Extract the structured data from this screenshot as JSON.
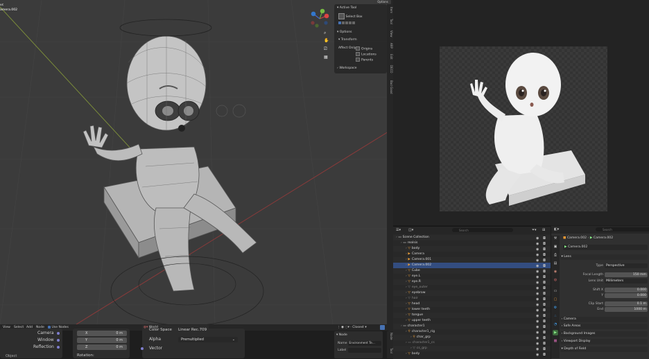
{
  "topbar": {
    "options_label": "Options"
  },
  "viewport": {
    "overlay_title": "vc",
    "overlay_subtitle": "amera.002",
    "n_panel": {
      "active_tool_header": "Active Tool",
      "select_box_label": "Select Box",
      "options_header": "Options",
      "transform_header": "Transform",
      "affect_only_label": "Affect Only",
      "origins_label": "Origins",
      "locations_label": "Locations",
      "parents_label": "Parents",
      "workspace_header": "Workspace"
    },
    "gizmo": {
      "x": "X",
      "y": "Y",
      "z": "Z"
    }
  },
  "side_tabs": [
    "Item",
    "Tool",
    "View",
    "ARP",
    "Edit",
    "DECO",
    "Bad Good"
  ],
  "outliner": {
    "search_placeholder": "Search",
    "rows": [
      {
        "name": "Scene Collection",
        "indent": 0,
        "icon": "collection",
        "color": "#d0d0d0",
        "selected": false
      },
      {
        "name": "realsis",
        "indent": 1,
        "icon": "collection",
        "color": "#d0d0d0",
        "selected": false
      },
      {
        "name": "body",
        "indent": 2,
        "icon": "mesh",
        "color": "#e39a3a",
        "selected": false
      },
      {
        "name": "Camera",
        "indent": 2,
        "icon": "camera",
        "color": "#e39a3a",
        "selected": false
      },
      {
        "name": "Camera.001",
        "indent": 2,
        "icon": "camera",
        "color": "#e39a3a",
        "selected": false
      },
      {
        "name": "Camera.002",
        "indent": 2,
        "icon": "camera",
        "color": "#e39a3a",
        "selected": true
      },
      {
        "name": "Cube",
        "indent": 2,
        "icon": "mesh",
        "color": "#e39a3a",
        "selected": false
      },
      {
        "name": "eye.L",
        "indent": 2,
        "icon": "mesh",
        "color": "#e39a3a",
        "selected": false
      },
      {
        "name": "eye.R",
        "indent": 2,
        "icon": "mesh",
        "color": "#e39a3a",
        "selected": false
      },
      {
        "name": "eye_outer",
        "indent": 2,
        "icon": "mesh",
        "color": "#777777",
        "selected": false
      },
      {
        "name": "eyebrow",
        "indent": 2,
        "icon": "mesh",
        "color": "#e39a3a",
        "selected": false
      },
      {
        "name": "hair",
        "indent": 2,
        "icon": "mesh",
        "color": "#777777",
        "selected": false
      },
      {
        "name": "head",
        "indent": 2,
        "icon": "mesh",
        "color": "#e39a3a",
        "selected": false
      },
      {
        "name": "lower teeth",
        "indent": 2,
        "icon": "mesh",
        "color": "#e39a3a",
        "selected": false
      },
      {
        "name": "tongue",
        "indent": 2,
        "icon": "mesh",
        "color": "#e39a3a",
        "selected": false
      },
      {
        "name": "upper teeth",
        "indent": 2,
        "icon": "mesh",
        "color": "#e39a3a",
        "selected": false
      },
      {
        "name": "character1",
        "indent": 1,
        "icon": "collection",
        "color": "#d0d0d0",
        "selected": false
      },
      {
        "name": "character1_rig",
        "indent": 2,
        "icon": "armature",
        "color": "#e39a3a",
        "selected": false
      },
      {
        "name": "char_grp",
        "indent": 3,
        "icon": "armature",
        "color": "#e39a3a",
        "selected": false
      },
      {
        "name": "character1_cs",
        "indent": 2,
        "icon": "collection",
        "color": "#777777",
        "selected": false
      },
      {
        "name": "cs_grp",
        "indent": 3,
        "icon": "mesh",
        "color": "#777777",
        "selected": false
      },
      {
        "name": "body",
        "indent": 2,
        "icon": "mesh",
        "color": "#e39a3a",
        "selected": false
      }
    ]
  },
  "properties": {
    "search_placeholder": "Search",
    "breadcrumb_object": "Camera.002",
    "breadcrumb_data": "Camera.002",
    "datablock_name": "Camera.002",
    "lens_header": "Lens",
    "type_label": "Type",
    "type_value": "Perspective",
    "focal_length_label": "Focal Length",
    "focal_length_value": "150 mm",
    "lens_unit_label": "Lens Unit",
    "lens_unit_value": "Millimeters",
    "shift_x_label": "Shift X",
    "shift_x_value": "0.000",
    "shift_y_label": "Y",
    "shift_y_value": "0.000",
    "clip_start_label": "Clip Start",
    "clip_start_value": "0.1 m",
    "clip_end_label": "End",
    "clip_end_value": "1000 m",
    "sections": [
      "Camera",
      "Safe Areas",
      "Background Images",
      "Viewport Display",
      "Depth of Field"
    ]
  },
  "node_editor": {
    "menu": [
      "View",
      "Select",
      "Add",
      "Node"
    ],
    "use_nodes_label": "Use Nodes",
    "world_name": "World",
    "slot_label": "Closest",
    "node_left": {
      "camera_label": "Camera",
      "window_label": "Window",
      "reflection_label": "Reflection",
      "bottom_label": "Object"
    },
    "node_mid": {
      "x_label": "X",
      "x_value": "0 m",
      "y_label": "Y",
      "y_value": "0 m",
      "z_label": "Z",
      "z_value": "0 m",
      "rotation_label": "Rotation:"
    },
    "node_right": {
      "color_space_label": "Color Space",
      "color_space_value": "Linear Rec.709",
      "alpha_label": "Alpha",
      "alpha_value": "Premultiplied",
      "vector_label": "Vector"
    },
    "side_panel": {
      "node_header": "Node",
      "name_label": "Name",
      "name_value": "Environment Te...",
      "label_label": "Label"
    },
    "side_tabs": [
      "Node",
      "Tool"
    ]
  }
}
